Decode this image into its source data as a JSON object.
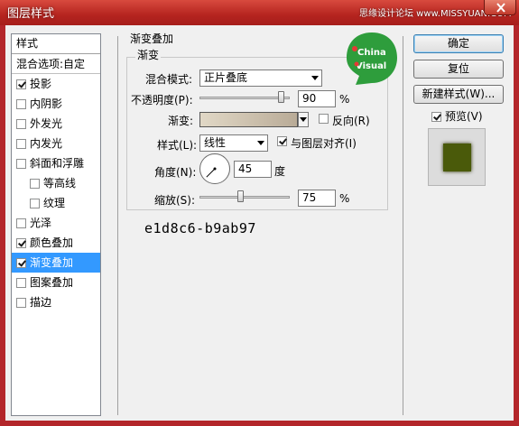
{
  "window": {
    "title": "图层样式",
    "watermark": "思缘设计论坛 www.MISSYUAN.COM"
  },
  "styles_list": {
    "header": "样式",
    "items": [
      {
        "label": "混合选项:自定",
        "checkbox": false,
        "checked": false,
        "sub": false,
        "selected": false
      },
      {
        "label": "投影",
        "checkbox": true,
        "checked": true,
        "sub": false,
        "selected": false
      },
      {
        "label": "内阴影",
        "checkbox": true,
        "checked": false,
        "sub": false,
        "selected": false
      },
      {
        "label": "外发光",
        "checkbox": true,
        "checked": false,
        "sub": false,
        "selected": false
      },
      {
        "label": "内发光",
        "checkbox": true,
        "checked": false,
        "sub": false,
        "selected": false
      },
      {
        "label": "斜面和浮雕",
        "checkbox": true,
        "checked": false,
        "sub": false,
        "selected": false
      },
      {
        "label": "等高线",
        "checkbox": true,
        "checked": false,
        "sub": true,
        "selected": false
      },
      {
        "label": "纹理",
        "checkbox": true,
        "checked": false,
        "sub": true,
        "selected": false
      },
      {
        "label": "光泽",
        "checkbox": true,
        "checked": false,
        "sub": false,
        "selected": false
      },
      {
        "label": "颜色叠加",
        "checkbox": true,
        "checked": true,
        "sub": false,
        "selected": false
      },
      {
        "label": "渐变叠加",
        "checkbox": true,
        "checked": true,
        "sub": false,
        "selected": true
      },
      {
        "label": "图案叠加",
        "checkbox": true,
        "checked": false,
        "sub": false,
        "selected": false
      },
      {
        "label": "描边",
        "checkbox": true,
        "checked": false,
        "sub": false,
        "selected": false
      }
    ]
  },
  "gradient_overlay": {
    "title": "渐变叠加",
    "section": "渐变",
    "blend_mode_label": "混合模式:",
    "blend_mode_value": "正片叠底",
    "opacity_label": "不透明度(P):",
    "opacity_value": "90",
    "opacity_percent": 90,
    "gradient_label": "渐变:",
    "gradient_start_color": "#e1d8c6",
    "gradient_end_color": "#b9ab97",
    "reverse_label": "反向(R)",
    "reverse_checked": false,
    "style_label": "样式(L):",
    "style_value": "线性",
    "align_label": "与图层对齐(I)",
    "align_checked": true,
    "angle_label": "角度(N):",
    "angle_value": "45",
    "angle_unit": "度",
    "scale_label": "缩放(S):",
    "scale_value": "75",
    "scale_percent": 75,
    "percent_sign": "%",
    "hex_note": "e1d8c6-b9ab97"
  },
  "logo": {
    "text_line1": "China",
    "text_line2": "Visual",
    "color": "#2e9d3c"
  },
  "buttons": {
    "ok": "确定",
    "reset": "复位",
    "new_style": "新建样式(W)...",
    "preview_label": "预览(V)",
    "preview_checked": true
  },
  "preview_color": "#4a5a0a"
}
